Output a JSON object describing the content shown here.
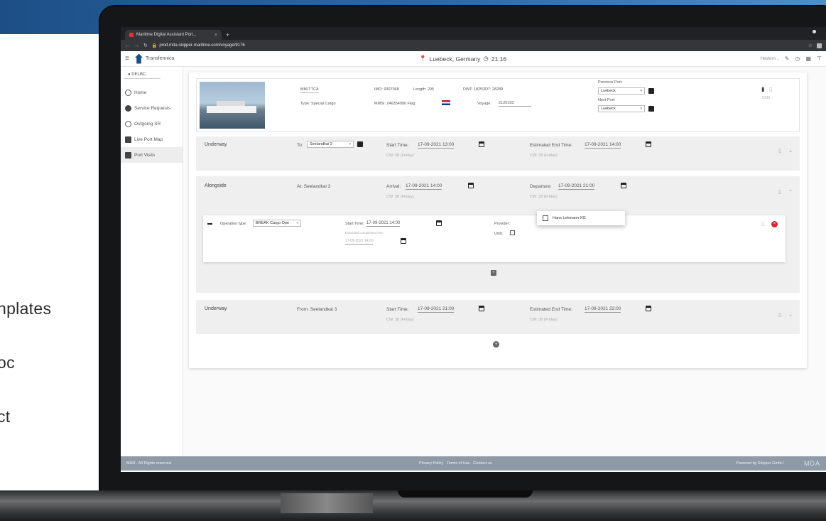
{
  "marketing": {
    "items": [
      "nplates",
      "oc",
      "ct"
    ]
  },
  "browser": {
    "tab_title": "Maritime Digital Assistant Port...",
    "tab_close": "×",
    "new_tab": "+",
    "url": "prod.mda.skipper-maritime.com/voyage/9176"
  },
  "app": {
    "brand": "Transfennica",
    "location": "Luebeck, Germany",
    "time": "21:16",
    "user": "Hestern..."
  },
  "sidebar": {
    "location_code": "DELBC",
    "items": [
      {
        "label": "Home",
        "icon": "home-icon"
      },
      {
        "label": "Service Requests",
        "icon": "service-icon"
      },
      {
        "label": "Outgoing SR",
        "icon": "outgoing-icon"
      },
      {
        "label": "Live Port Map",
        "icon": "map-icon"
      },
      {
        "label": "Port Visits",
        "icon": "port-visits-icon"
      }
    ]
  },
  "vessel": {
    "name": "MIKITTCA",
    "type": "Type: Special Cargo",
    "imo": "IMO: 9307968",
    "length": "Length: 205",
    "mmsi": "MMSI: 246354000 Flag:",
    "dwt": "DWT: 1825DDT: 28289",
    "voyage_label": "Voyage:",
    "voyage": "2120193",
    "prev_port_label": "Previous Port:",
    "prev_port": "Luebeck",
    "next_port_label": "Next Port:",
    "next_port": "Luebeck",
    "co2": "CO2"
  },
  "segments": [
    {
      "label": "Underway",
      "to_label": "To:",
      "to": "Seelandkai 3",
      "start_label": "Start Time:",
      "start": "17-09-2021 13:00",
      "start_sub": "CW: 38 (Friday)",
      "end_label": "Estimated End Time:",
      "end": "17-09-2021 14:00",
      "end_sub": "CW: 38 (Friday)"
    },
    {
      "label": "Alongside",
      "at": "At: Seelandkai 3",
      "arrival_label": "Arrival:",
      "arrival": "17-09-2021 14:00",
      "arrival_sub": "CW: 38 (Friday)",
      "departure_label": "Departure:",
      "departure": "17-09-2021 21:00",
      "departure_sub": "CW: 38 (Friday)"
    },
    {
      "label": "Underway",
      "from": "From: Seelandkai 3",
      "start_label": "Start Time:",
      "start": "17-09-2021 21:00",
      "start_sub": "CW: 38 (Friday)",
      "end_label": "Estimated End Time:",
      "end": "17-09-2021 22:00",
      "end_sub": "CW: 38 (Friday)"
    }
  ],
  "operation": {
    "type_label": "Operation type:",
    "type": "BREAK Cargo Ope",
    "start_label": "Start Time:",
    "start": "17-09-2021 14:00",
    "est_label": "Estimated completion time:",
    "est": "17-09-2021 14:00",
    "provider_label": "Provider:",
    "provider_option": "Hans Lehmann KG",
    "units_label": "Units:"
  },
  "footer": {
    "left": "MAN - All Rights reserved",
    "mid": "Privacy Policy · Terms of Use · Contact us",
    "right": "Powered by Skipper GmbH",
    "mark": "MDA"
  },
  "colors": {
    "accent": "#1d4f86",
    "danger": "#d9232d",
    "footer": "#8e9aa6"
  }
}
